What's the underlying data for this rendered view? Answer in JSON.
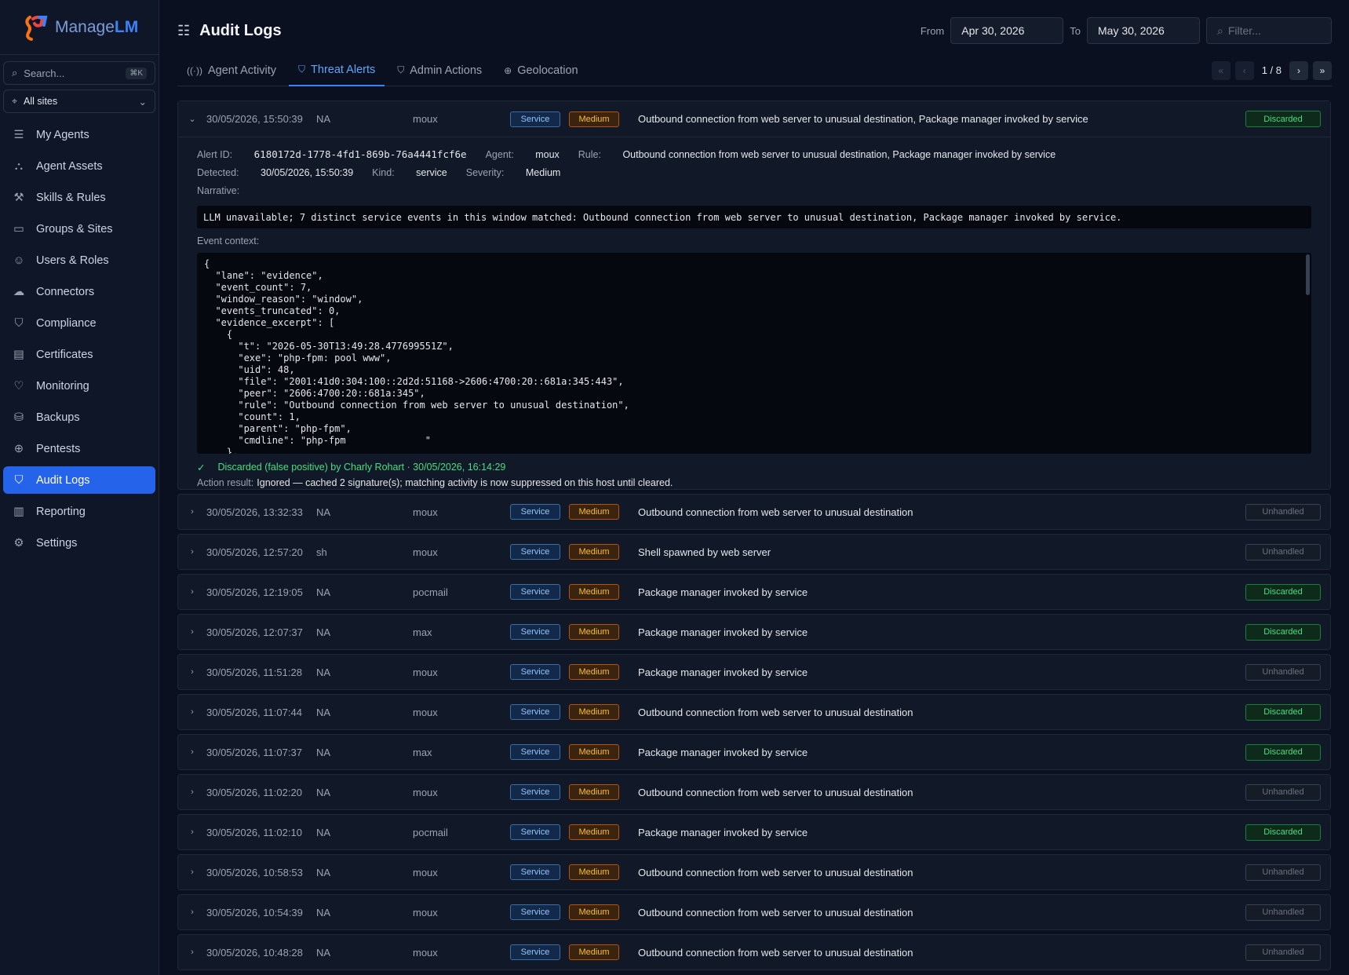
{
  "app": {
    "logo_prefix": "Manage",
    "logo_suffix": "LM"
  },
  "sidebar": {
    "search_placeholder": "Search...",
    "search_shortcut": "⌘K",
    "site_selector": "All sites",
    "items": [
      {
        "label": "My Agents",
        "icon": "server-icon"
      },
      {
        "label": "Agent Assets",
        "icon": "assets-icon"
      },
      {
        "label": "Skills & Rules",
        "icon": "wrench-icon"
      },
      {
        "label": "Groups & Sites",
        "icon": "folder-icon"
      },
      {
        "label": "Users & Roles",
        "icon": "users-icon"
      },
      {
        "label": "Connectors",
        "icon": "cloud-icon"
      },
      {
        "label": "Compliance",
        "icon": "shield-check-icon"
      },
      {
        "label": "Certificates",
        "icon": "certificate-icon"
      },
      {
        "label": "Monitoring",
        "icon": "heart-pulse-icon"
      },
      {
        "label": "Backups",
        "icon": "hard-drive-icon"
      },
      {
        "label": "Pentests",
        "icon": "crosshair-icon"
      },
      {
        "label": "Audit Logs",
        "icon": "shield-icon",
        "active": true
      },
      {
        "label": "Reporting",
        "icon": "report-icon"
      },
      {
        "label": "Settings",
        "icon": "gear-icon"
      }
    ]
  },
  "header": {
    "title": "Audit Logs",
    "from_label": "From",
    "from_date": "Apr 30, 2026",
    "to_label": "To",
    "to_date": "May 30, 2026",
    "filter_placeholder": "Filter..."
  },
  "tabs": [
    {
      "label": "Agent Activity",
      "icon": "broadcast-icon"
    },
    {
      "label": "Threat Alerts",
      "icon": "shield-alert-icon",
      "active": true
    },
    {
      "label": "Admin Actions",
      "icon": "shield-icon"
    },
    {
      "label": "Geolocation",
      "icon": "globe-icon"
    }
  ],
  "pager": {
    "text": "1 / 8"
  },
  "expanded": {
    "timestamp": "30/05/2026, 15:50:39",
    "process": "NA",
    "agent": "moux",
    "kind": "Service",
    "severity": "Medium",
    "rule": "Outbound connection from web server to unusual destination, Package manager invoked by service",
    "status": "Discarded",
    "alert_id_label": "Alert ID:",
    "alert_id": "6180172d-1778-4fd1-869b-76a4441fcf6e",
    "agent_label": "Agent:",
    "agent_value": "moux",
    "rule_label": "Rule:",
    "rule_value": "Outbound connection from web server to unusual destination, Package manager invoked by service",
    "detected_label": "Detected:",
    "detected_value": "30/05/2026, 15:50:39",
    "kind_label": "Kind:",
    "kind_value": "service",
    "severity_label": "Severity:",
    "severity_value": "Medium",
    "narrative_label": "Narrative:",
    "narrative": "LLM unavailable; 7 distinct service events in this window matched: Outbound connection from web server to unusual destination, Package manager invoked by service.",
    "context_label": "Event context:",
    "context": "{\n  \"lane\": \"evidence\",\n  \"event_count\": 7,\n  \"window_reason\": \"window\",\n  \"events_truncated\": 0,\n  \"evidence_excerpt\": [\n    {\n      \"t\": \"2026-05-30T13:49:28.477699551Z\",\n      \"exe\": \"php-fpm: pool www\",\n      \"uid\": 48,\n      \"file\": \"2001:41d0:304:100::2d2d:51168->2606:4700:20::681a:345:443\",\n      \"peer\": \"2606:4700:20::681a:345\",\n      \"rule\": \"Outbound connection from web server to unusual destination\",\n      \"count\": 1,\n      \"parent\": \"php-fpm\",\n      \"cmdline\": \"php-fpm              \"\n    },",
    "resolution": "Discarded (false positive) by Charly Rohart · 30/05/2026, 16:14:29",
    "action_label": "Action result:",
    "action_value": "Ignored — cached 2 signature(s); matching activity is now suppressed on this host until cleared."
  },
  "rows": [
    {
      "timestamp": "30/05/2026, 13:32:33",
      "process": "NA",
      "agent": "moux",
      "kind": "Service",
      "severity": "Medium",
      "rule": "Outbound connection from web server to unusual destination",
      "status": "Unhandled"
    },
    {
      "timestamp": "30/05/2026, 12:57:20",
      "process": "sh",
      "agent": "moux",
      "kind": "Service",
      "severity": "Medium",
      "rule": "Shell spawned by web server",
      "status": "Unhandled"
    },
    {
      "timestamp": "30/05/2026, 12:19:05",
      "process": "NA",
      "agent": "pocmail",
      "kind": "Service",
      "severity": "Medium",
      "rule": "Package manager invoked by service",
      "status": "Discarded"
    },
    {
      "timestamp": "30/05/2026, 12:07:37",
      "process": "NA",
      "agent": "max",
      "kind": "Service",
      "severity": "Medium",
      "rule": "Package manager invoked by service",
      "status": "Discarded"
    },
    {
      "timestamp": "30/05/2026, 11:51:28",
      "process": "NA",
      "agent": "moux",
      "kind": "Service",
      "severity": "Medium",
      "rule": "Package manager invoked by service",
      "status": "Unhandled"
    },
    {
      "timestamp": "30/05/2026, 11:07:44",
      "process": "NA",
      "agent": "moux",
      "kind": "Service",
      "severity": "Medium",
      "rule": "Outbound connection from web server to unusual destination",
      "status": "Discarded"
    },
    {
      "timestamp": "30/05/2026, 11:07:37",
      "process": "NA",
      "agent": "max",
      "kind": "Service",
      "severity": "Medium",
      "rule": "Package manager invoked by service",
      "status": "Discarded"
    },
    {
      "timestamp": "30/05/2026, 11:02:20",
      "process": "NA",
      "agent": "moux",
      "kind": "Service",
      "severity": "Medium",
      "rule": "Outbound connection from web server to unusual destination",
      "status": "Unhandled"
    },
    {
      "timestamp": "30/05/2026, 11:02:10",
      "process": "NA",
      "agent": "pocmail",
      "kind": "Service",
      "severity": "Medium",
      "rule": "Package manager invoked by service",
      "status": "Discarded"
    },
    {
      "timestamp": "30/05/2026, 10:58:53",
      "process": "NA",
      "agent": "moux",
      "kind": "Service",
      "severity": "Medium",
      "rule": "Outbound connection from web server to unusual destination",
      "status": "Unhandled"
    },
    {
      "timestamp": "30/05/2026, 10:54:39",
      "process": "NA",
      "agent": "moux",
      "kind": "Service",
      "severity": "Medium",
      "rule": "Outbound connection from web server to unusual destination",
      "status": "Unhandled"
    },
    {
      "timestamp": "30/05/2026, 10:48:28",
      "process": "NA",
      "agent": "moux",
      "kind": "Service",
      "severity": "Medium",
      "rule": "Outbound connection from web server to unusual destination",
      "status": "Unhandled"
    }
  ]
}
